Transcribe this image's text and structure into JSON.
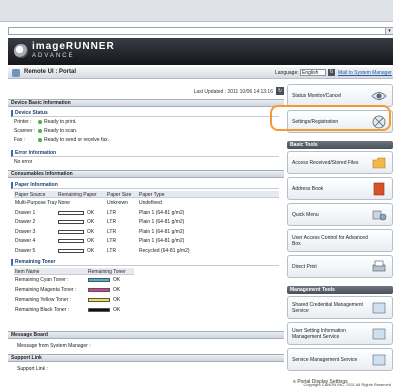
{
  "header": {
    "product_line1": "imageRUNNER",
    "product_line2": "ADVANCE",
    "portal_title": "Remote UI : Portal",
    "language_label": "Language:",
    "language_value": "English",
    "mail_link": "Mail to System Manager"
  },
  "main": {
    "last_updated": "Last Updated : 2011 10/06 14:13:16",
    "device_basic_info": "Device Basic Information",
    "device_status": "Device Status",
    "status_rows": [
      {
        "label": "Printer :",
        "value": "Ready to print."
      },
      {
        "label": "Scanner :",
        "value": "Ready to scan."
      },
      {
        "label": "Fax :",
        "value": "Ready to send or receive fax."
      }
    ],
    "error_info": "Error Information",
    "error_text": "No error",
    "consumables_info": "Consumables Information",
    "paper_info": "Paper Information",
    "paper_headers": [
      "Paper Source",
      "Remaining Paper",
      "Paper Size",
      "Paper Type"
    ],
    "paper_rows": [
      {
        "source": "Multi-Purpose Tray",
        "remaining": "None",
        "size": "Unknown",
        "type": "Undefined",
        "gauge": null
      },
      {
        "source": "Drawer 1",
        "remaining": "OK",
        "size": "LTR",
        "type": "Plain 1 (64-81 g/m2)",
        "gauge": 1
      },
      {
        "source": "Drawer 2",
        "remaining": "OK",
        "size": "LTR",
        "type": "Plain 1 (64-81 g/m2)",
        "gauge": 1
      },
      {
        "source": "Drawer 3",
        "remaining": "OK",
        "size": "LTR",
        "type": "Plain 1 (64-81 g/m2)",
        "gauge": 1
      },
      {
        "source": "Drawer 4",
        "remaining": "OK",
        "size": "LTR",
        "type": "Plain 1 (64-81 g/m2)",
        "gauge": 1
      },
      {
        "source": "Drawer 5",
        "remaining": "OK",
        "size": "LTR",
        "type": "Recycled (64-81 g/m2)",
        "gauge": 1
      }
    ],
    "remaining_toner": "Remaining Toner",
    "toner_headers": [
      "Item Name",
      "Remaining Toner"
    ],
    "toner_rows": [
      {
        "name": "Remaining Cyan Toner :",
        "value": "OK",
        "color": "#3fb7d8"
      },
      {
        "name": "Remaining Magenta Toner :",
        "value": "OK",
        "color": "#d83c9a"
      },
      {
        "name": "Remaining Yellow Toner :",
        "value": "OK",
        "color": "#f0e040"
      },
      {
        "name": "Remaining Black Toner :",
        "value": "OK",
        "color": "#111111"
      }
    ],
    "message_board": "Message Board",
    "message_text": "Message from System Manager :",
    "support_link": "Support Link",
    "support_text": "Support Link :"
  },
  "side": {
    "status_monitor": "Status Monitor/Cancel",
    "settings": "Settings/Registration",
    "basic_tools": "Basic Tools",
    "access_received": "Access Received/Stored Files",
    "address_book": "Address Book",
    "quick_menu": "Quick Menu",
    "user_access_control": "User Access Control for Advanced Box",
    "direct_print": "Direct Print",
    "management_tools": "Management Tools",
    "shared_credential": "Shared Credential Management Service",
    "user_setting_info": "User Setting Information Management Service",
    "service_management": "Service Management Service",
    "portal_display": "Portal Display Settings"
  },
  "footer": {
    "copyright": "Copyright CANON INC. 2011 All Rights Reserved"
  }
}
